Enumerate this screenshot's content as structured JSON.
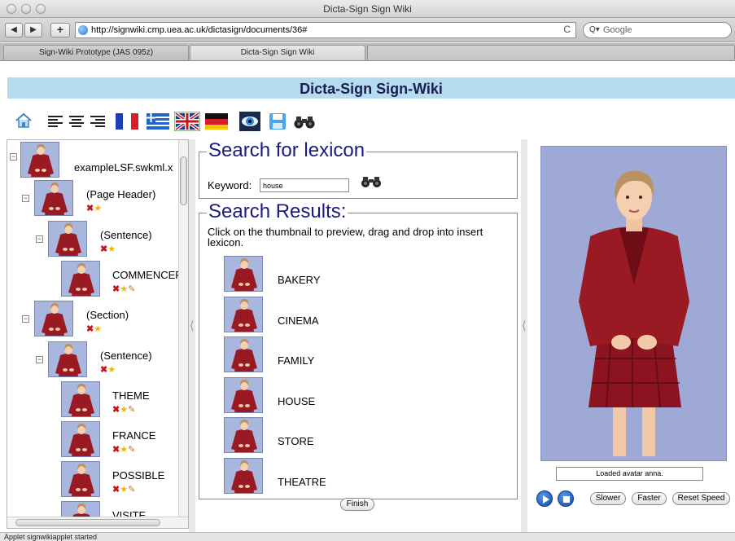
{
  "window": {
    "title": "Dicta-Sign Sign Wiki"
  },
  "toolbar": {
    "url": "http://signwiki.cmp.uea.ac.uk/dictasign/documents/36#",
    "search_placeholder": "Google",
    "back_icon": "back-arrow-icon",
    "forward_icon": "forward-arrow-icon",
    "add_bookmark_icon": "plus-icon"
  },
  "tabs": [
    {
      "label": "Sign-Wiki Prototype (JAS 095z)",
      "active": false
    },
    {
      "label": "Dicta-Sign Sign Wiki",
      "active": true
    }
  ],
  "site": {
    "title": "Dicta-Sign Sign-Wiki",
    "banner_color": "#b4dbee"
  },
  "toolbar_icons": [
    "home-icon",
    "align-left-icon",
    "align-center-icon",
    "align-right-icon",
    "flag-france-icon",
    "flag-greece-icon",
    "flag-uk-icon",
    "flag-germany-icon",
    "eye-view-icon",
    "save-disk-icon",
    "binoculars-icon"
  ],
  "tree": {
    "file": "exampleLSF.swkml.x",
    "nodes": [
      {
        "label": "(Page Header)",
        "actions": "xs"
      },
      {
        "label": "(Sentence)",
        "actions": "xs"
      },
      {
        "label": "COMMENCER",
        "actions": "xsp"
      },
      {
        "label": "(Section)",
        "actions": "xs"
      },
      {
        "label": "(Sentence)",
        "actions": "xs"
      },
      {
        "label": "THEME",
        "actions": "xsp"
      },
      {
        "label": "FRANCE",
        "actions": "xsp"
      },
      {
        "label": "POSSIBLE",
        "actions": "xsp"
      },
      {
        "label": "VISITE",
        "actions": ""
      }
    ]
  },
  "search": {
    "heading": "Search for lexicon",
    "keyword_label": "Keyword:",
    "keyword_value": "house",
    "results_heading": "Search Results:",
    "instructions": "Click on the thumbnail to preview, drag and drop into insert lexicon.",
    "results": [
      "BAKERY",
      "CINEMA",
      "FAMILY",
      "HOUSE",
      "STORE",
      "THEATRE"
    ],
    "finish_label": "Finish"
  },
  "avatar": {
    "status": "Loaded avatar anna.",
    "slower_label": "Slower",
    "faster_label": "Faster",
    "reset_label": "Reset Speed",
    "background_color": "#9fa9d6"
  },
  "statusbar": {
    "text": "Applet signwikiapplet started"
  }
}
